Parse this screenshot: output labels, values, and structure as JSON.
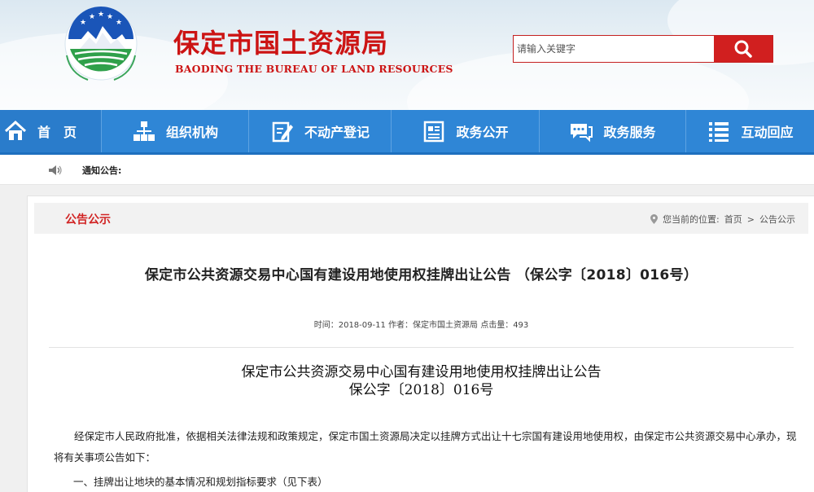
{
  "header": {
    "title": "保定市国土资源局",
    "subtitle": "BAODING THE BUREAU OF LAND RESOURCES",
    "search_placeholder": "请输入关键字",
    "colors": {
      "brand_red": "#cc1414",
      "nav_blue": "#2f86d6"
    }
  },
  "nav": {
    "items": [
      {
        "label": "首　页",
        "icon": "home-icon"
      },
      {
        "label": "组织机构",
        "icon": "org-chart-icon"
      },
      {
        "label": "不动产登记",
        "icon": "edit-document-icon"
      },
      {
        "label": "政务公开",
        "icon": "news-document-icon"
      },
      {
        "label": "政务服务",
        "icon": "chat-bubble-icon"
      },
      {
        "label": "互动回应",
        "icon": "list-icon"
      }
    ]
  },
  "notice": {
    "label": "通知公告:",
    "icon": "speaker-icon"
  },
  "section": {
    "title": "公告公示",
    "location_label": "您当前的位置:",
    "breadcrumb": [
      "首页",
      ">",
      "公告公示"
    ]
  },
  "article": {
    "title": "保定市公共资源交易中心国有建设用地使用权挂牌出让公告 （保公字〔2018〕016号）",
    "meta": "时间：2018-09-11 作者：保定市国土资源局 点击量：493",
    "doc_title_line1": "保定市公共资源交易中心国有建设用地使用权挂牌出让公告",
    "doc_title_line2": "保公字〔2018〕016号",
    "paragraph1": "经保定市人民政府批准，依据相关法律法规和政策规定，保定市国土资源局决定以挂牌方式出让十七宗国有建设用地使用权，由保定市公共资源交易中心承办，现将有关事项公告如下：",
    "paragraph2": "一、挂牌出让地块的基本情况和规划指标要求（见下表）"
  }
}
